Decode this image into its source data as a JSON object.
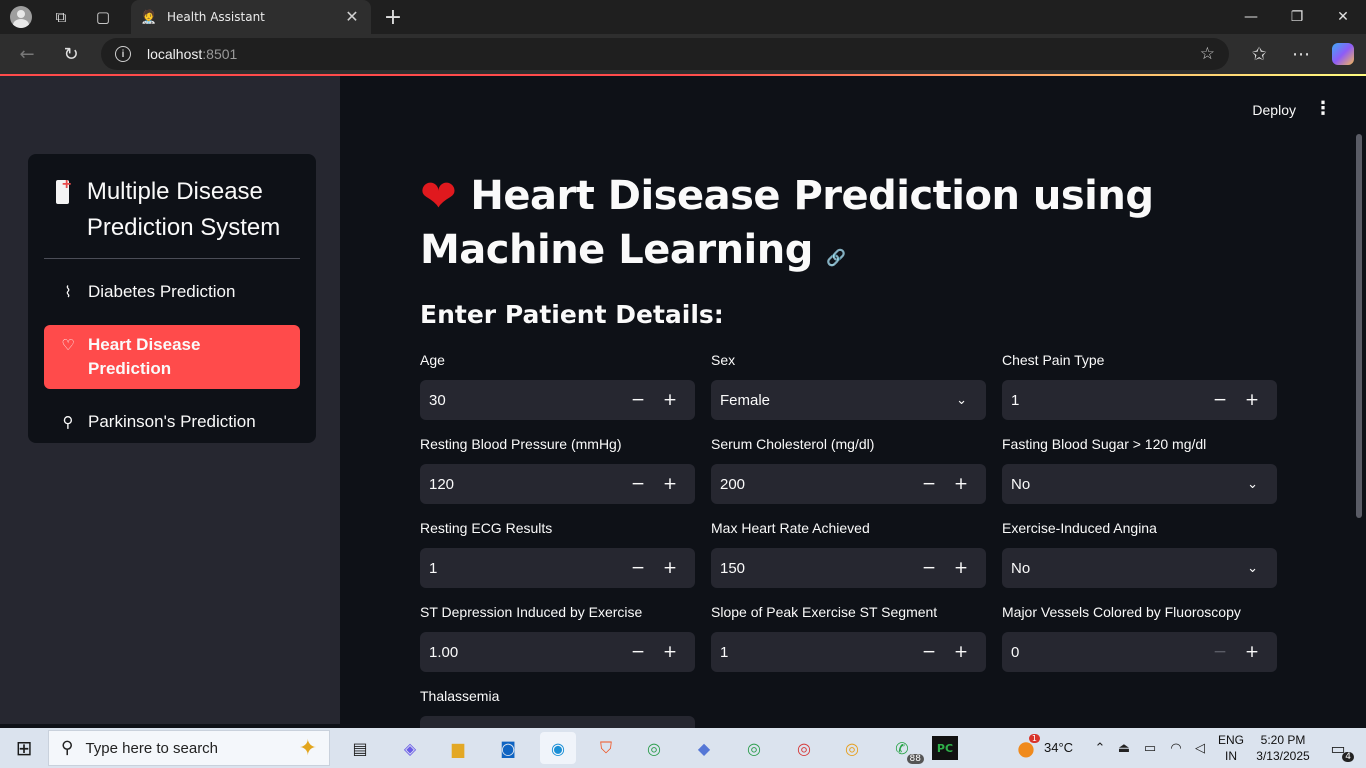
{
  "browser": {
    "tab_title": "Health Assistant",
    "url_host": "localhost",
    "url_port": ":8501"
  },
  "app": {
    "deploy_label": "Deploy",
    "sidebar": {
      "title": "Multiple Disease Prediction System",
      "items": [
        {
          "label": "Diabetes Prediction",
          "icon": "activity-icon",
          "active": false
        },
        {
          "label": "Heart Disease Prediction",
          "icon": "heart-icon",
          "active": true
        },
        {
          "label": "Parkinson's Prediction",
          "icon": "person-icon",
          "active": false
        }
      ]
    },
    "page_title": "Heart Disease Prediction using Machine Learning",
    "subheader": "Enter Patient Details:",
    "fields": {
      "age": {
        "label": "Age",
        "value": "30"
      },
      "sex": {
        "label": "Sex",
        "value": "Female"
      },
      "cp": {
        "label": "Chest Pain Type",
        "value": "1"
      },
      "trestbps": {
        "label": "Resting Blood Pressure (mmHg)",
        "value": "120"
      },
      "chol": {
        "label": "Serum Cholesterol (mg/dl)",
        "value": "200"
      },
      "fbs": {
        "label": "Fasting Blood Sugar > 120 mg/dl",
        "value": "No"
      },
      "restecg": {
        "label": "Resting ECG Results",
        "value": "1"
      },
      "thalach": {
        "label": "Max Heart Rate Achieved",
        "value": "150"
      },
      "exang": {
        "label": "Exercise-Induced Angina",
        "value": "No"
      },
      "oldpeak": {
        "label": "ST Depression Induced by Exercise",
        "value": "1.00"
      },
      "slope": {
        "label": "Slope of Peak Exercise ST Segment",
        "value": "1"
      },
      "ca": {
        "label": "Major Vessels Colored by Fluoroscopy",
        "value": "0"
      },
      "thal": {
        "label": "Thalassemia"
      }
    }
  },
  "taskbar": {
    "search_placeholder": "Type here to search",
    "weather_temp": "34°C",
    "weather_badge": "1",
    "whatsapp_badge": "88",
    "language_line1": "ENG",
    "language_line2": "IN",
    "time": "5:20 PM",
    "date": "3/13/2025",
    "notification_count": "4"
  }
}
